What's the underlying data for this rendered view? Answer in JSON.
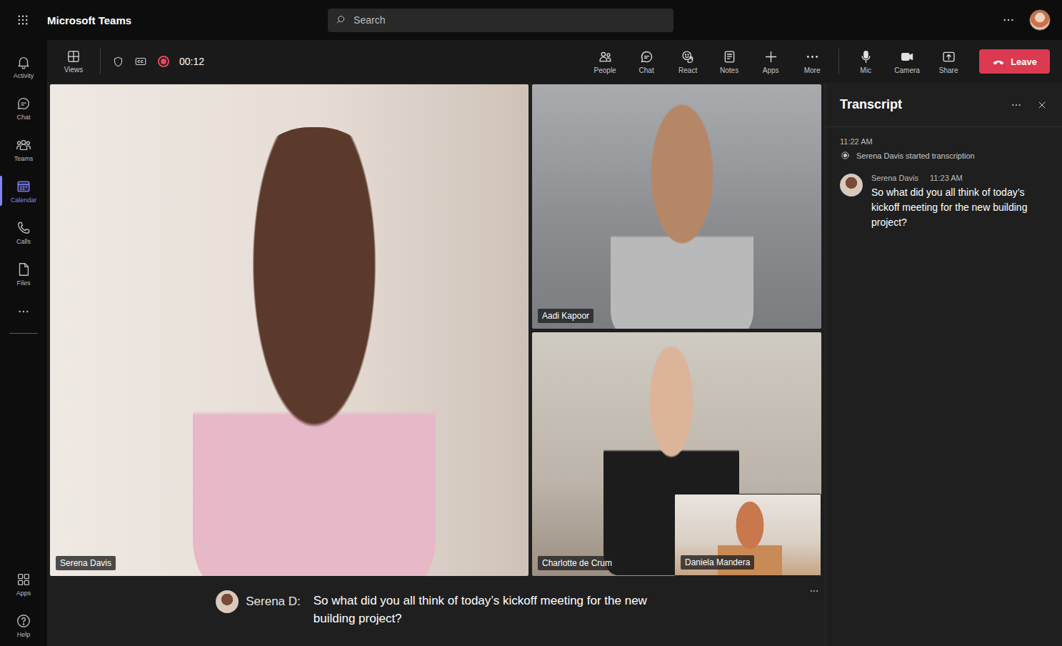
{
  "app": {
    "title": "Microsoft Teams",
    "search_placeholder": "Search"
  },
  "rail": {
    "items": [
      {
        "label": "Activity",
        "selected": false
      },
      {
        "label": "Chat",
        "selected": false
      },
      {
        "label": "Teams",
        "selected": false
      },
      {
        "label": "Calendar",
        "selected": true
      },
      {
        "label": "Calls",
        "selected": false
      },
      {
        "label": "Files",
        "selected": false
      }
    ],
    "bottom": [
      {
        "label": "Apps"
      },
      {
        "label": "Help"
      }
    ]
  },
  "meeting": {
    "views": "Views",
    "recording": true,
    "timer": "00:12",
    "actions": [
      {
        "label": "People"
      },
      {
        "label": "Chat"
      },
      {
        "label": "React"
      },
      {
        "label": "Notes"
      },
      {
        "label": "Apps"
      },
      {
        "label": "More"
      }
    ],
    "devices": [
      {
        "label": "Mic"
      },
      {
        "label": "Camera"
      },
      {
        "label": "Share"
      }
    ],
    "leave": "Leave"
  },
  "participants": [
    {
      "name": "Serena Davis",
      "kind": "main"
    },
    {
      "name": "Aadi Kapoor",
      "kind": "tile"
    },
    {
      "name": "Charlotte de Crum",
      "kind": "tile"
    },
    {
      "name": "Daniela Mandera",
      "kind": "inset"
    }
  ],
  "caption": {
    "speaker": "Serena D:",
    "text": "So what did you all think of today’s kickoff meeting for the new building project?"
  },
  "transcript": {
    "title": "Transcript",
    "events": [
      {
        "time": "11:22 AM",
        "text": "Serena Davis started transcription"
      }
    ],
    "entries": [
      {
        "speaker": "Serena Davis",
        "time": "11:23 AM",
        "text": "So what did you all think of today’s kickoff meeting for the new building project?"
      }
    ]
  }
}
